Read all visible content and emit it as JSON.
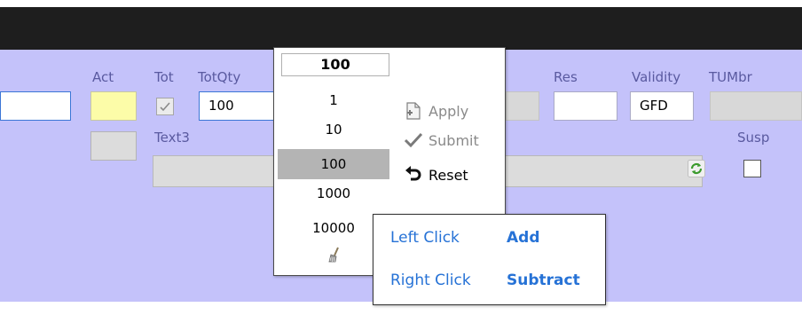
{
  "labels": {
    "act": "Act",
    "tot": "Tot",
    "totqty": "TotQty",
    "text3": "Text3",
    "res": "Res",
    "validity": "Validity",
    "tumbr": "TUMbr",
    "susp": "Susp"
  },
  "fields": {
    "totqty_value": "100",
    "validity_value": "GFD",
    "tot_checked": true,
    "susp_checked": false
  },
  "quantity_popup": {
    "current": "100",
    "options": [
      "1",
      "10",
      "100",
      "1000",
      "10000"
    ],
    "selected": "100"
  },
  "actions": {
    "apply": "Apply",
    "submit": "Submit",
    "reset": "Reset"
  },
  "tooltip": {
    "left_click": "Left Click",
    "left_action": "Add",
    "right_click": "Right Click",
    "right_action": "Subtract"
  },
  "colors": {
    "panel": "#c4c2fa",
    "titlebar": "#1e1e1e",
    "label": "#5a5aa0",
    "tooltip_text": "#2672d6",
    "act_field": "#fcfca8"
  },
  "icons": [
    "apply-icon",
    "submit-check-icon",
    "reset-undo-icon",
    "broom-icon",
    "refresh-icon"
  ]
}
